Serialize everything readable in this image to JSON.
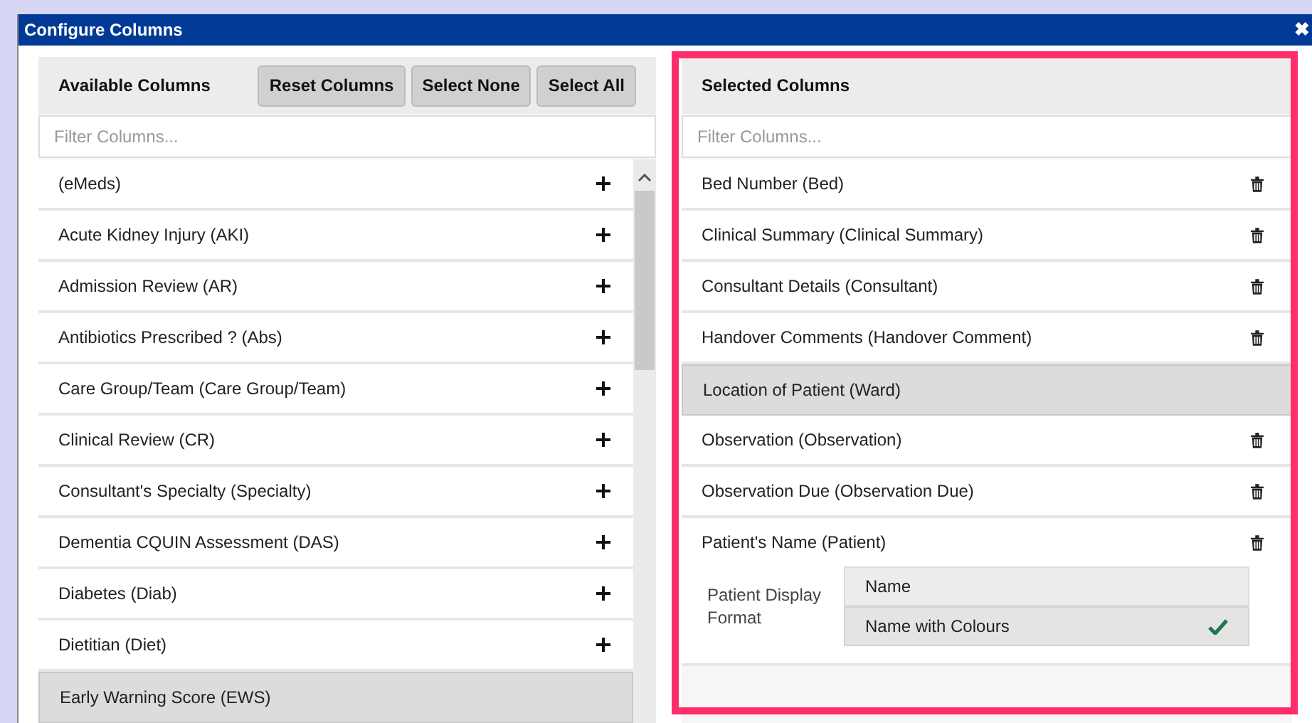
{
  "window": {
    "title": "Configure Columns",
    "close": "✖"
  },
  "available": {
    "title": "Available Columns",
    "buttons": [
      "Reset Columns",
      "Select None",
      "Select All"
    ],
    "filter": {
      "placeholder": "Filter Columns..."
    },
    "items": [
      {
        "label": "(eMeds)",
        "locked": false
      },
      {
        "label": "Acute Kidney Injury (AKI)",
        "locked": false
      },
      {
        "label": "Admission Review (AR)",
        "locked": false
      },
      {
        "label": "Antibiotics Prescribed ? (Abs)",
        "locked": false
      },
      {
        "label": "Care Group/Team (Care Group/Team)",
        "locked": false
      },
      {
        "label": "Clinical Review (CR)",
        "locked": false
      },
      {
        "label": "Consultant's Specialty (Specialty)",
        "locked": false
      },
      {
        "label": "Dementia CQUIN Assessment (DAS)",
        "locked": false
      },
      {
        "label": "Diabetes (Diab)",
        "locked": false
      },
      {
        "label": "Dietitian (Diet)",
        "locked": false
      },
      {
        "label": "Early Warning Score (EWS)",
        "locked": true
      }
    ]
  },
  "selected": {
    "title": "Selected Columns",
    "filter": {
      "placeholder": "Filter Columns..."
    },
    "items": [
      {
        "label": "Bed Number (Bed)",
        "locked": false
      },
      {
        "label": "Clinical Summary (Clinical Summary)",
        "locked": false
      },
      {
        "label": "Consultant Details (Consultant)",
        "locked": false
      },
      {
        "label": "Handover Comments (Handover Comment)",
        "locked": false
      },
      {
        "label": "Location of Patient (Ward)",
        "locked": true
      },
      {
        "label": "Observation (Observation)",
        "locked": false
      },
      {
        "label": "Observation Due (Observation Due)",
        "locked": false
      },
      {
        "label": "Patient's Name (Patient)",
        "locked": false,
        "format": {
          "label": "Patient Display Format",
          "options": [
            {
              "label": "Name",
              "selected": false
            },
            {
              "label": "Name with Colours",
              "selected": true
            }
          ]
        }
      }
    ]
  },
  "highlight": {
    "on": true
  }
}
